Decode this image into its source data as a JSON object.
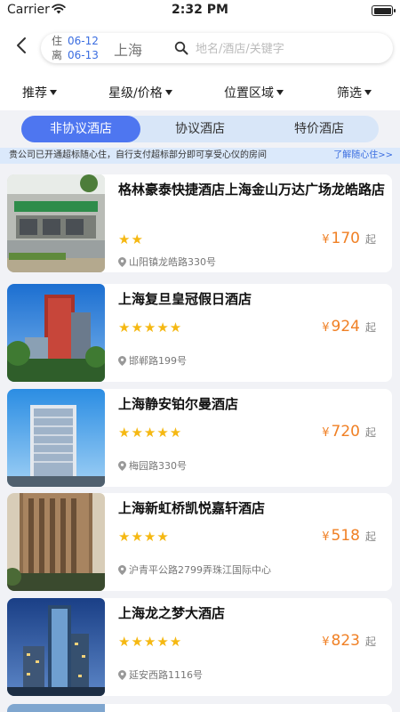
{
  "status_bar": {
    "carrier": "Carrier",
    "time": "2:32 PM"
  },
  "header": {
    "checkin_label": "住",
    "checkin_date": "06-12",
    "checkout_label": "离",
    "checkout_date": "06-13",
    "city": "上海",
    "search_placeholder": "地名/酒店/关键字"
  },
  "filters": [
    {
      "label": "推荐"
    },
    {
      "label": "星级/价格"
    },
    {
      "label": "位置区域"
    },
    {
      "label": "筛选"
    }
  ],
  "tabs": [
    {
      "label": "非协议酒店",
      "active": true
    },
    {
      "label": "协议酒店",
      "active": false
    },
    {
      "label": "特价酒店",
      "active": false
    }
  ],
  "notice": {
    "text": "贵公司已开通超标随心住，自行支付超标部分即可享受心仪的房间",
    "link": "了解随心住>>"
  },
  "hotels": [
    {
      "name": "格林豪泰快捷酒店上海金山万达广场龙皓路店",
      "stars": "★★",
      "currency": "¥",
      "price": "170",
      "suffix": "起",
      "address": "山阳镇龙皓路330号"
    },
    {
      "name": "上海复旦皇冠假日酒店",
      "stars": "★★★★★",
      "currency": "¥",
      "price": "924",
      "suffix": "起",
      "address": "邯郸路199号"
    },
    {
      "name": "上海静安铂尔曼酒店",
      "stars": "★★★★★",
      "currency": "¥",
      "price": "720",
      "suffix": "起",
      "address": "梅园路330号"
    },
    {
      "name": "上海新虹桥凯悦嘉轩酒店",
      "stars": "★★★★",
      "currency": "¥",
      "price": "518",
      "suffix": "起",
      "address": "沪青平公路2799弄珠江国际中心"
    },
    {
      "name": "上海龙之梦大酒店",
      "stars": "★★★★★",
      "currency": "¥",
      "price": "823",
      "suffix": "起",
      "address": "延安西路1116号"
    }
  ],
  "colors": {
    "accent": "#4e76f0",
    "price": "#f08025",
    "star": "#f5b812",
    "link": "#3a6de0"
  }
}
